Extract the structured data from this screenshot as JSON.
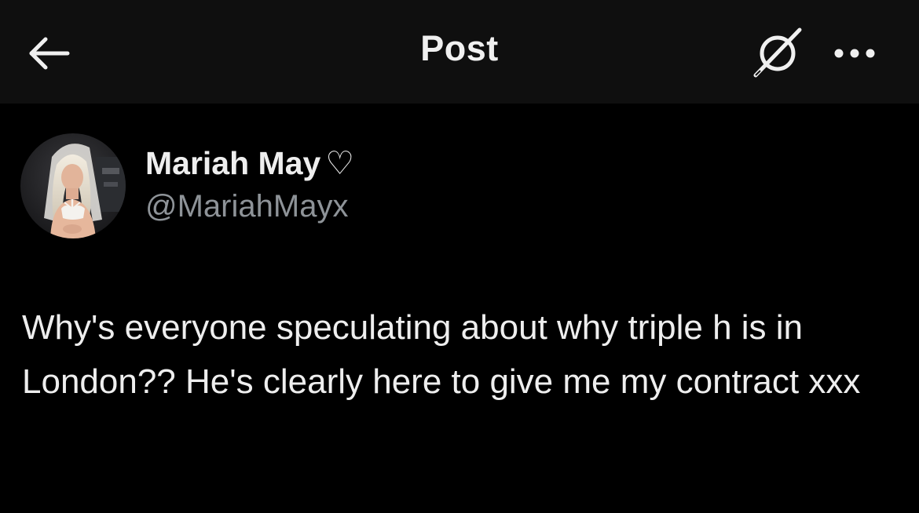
{
  "header": {
    "title": "Post",
    "back_icon": "arrow-left-icon",
    "grok_icon": "grok-icon",
    "more_icon": "more-dots-icon"
  },
  "author": {
    "name": "Mariah May",
    "name_suffix": "♡",
    "handle": "@MariahMayx"
  },
  "post": {
    "text": "Why's everyone speculating about why triple h is in London?? He's clearly here to give me my contract xxx"
  },
  "colors": {
    "background": "#000000",
    "header_background": "#0f0f0f",
    "primary_text": "#eeeeee",
    "secondary_text": "#8e9398"
  }
}
